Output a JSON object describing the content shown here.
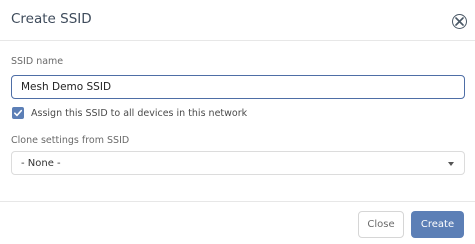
{
  "dialog": {
    "title": "Create SSID",
    "ssid_name_label": "SSID name",
    "ssid_name_value": "Mesh Demo SSID",
    "assign_checkbox": {
      "checked": true,
      "label": "Assign this SSID to all devices in this network"
    },
    "clone_label": "Clone settings from SSID",
    "clone_select": {
      "selected": "- None -"
    },
    "buttons": {
      "close": "Close",
      "create": "Create"
    }
  },
  "colors": {
    "accent": "#5c7fb6",
    "input_border": "#4e6ea6",
    "title_text": "#3e4b5b"
  },
  "icons": {
    "close": "close-circle-icon",
    "check": "check-icon",
    "dropdown": "caret-down-icon"
  }
}
